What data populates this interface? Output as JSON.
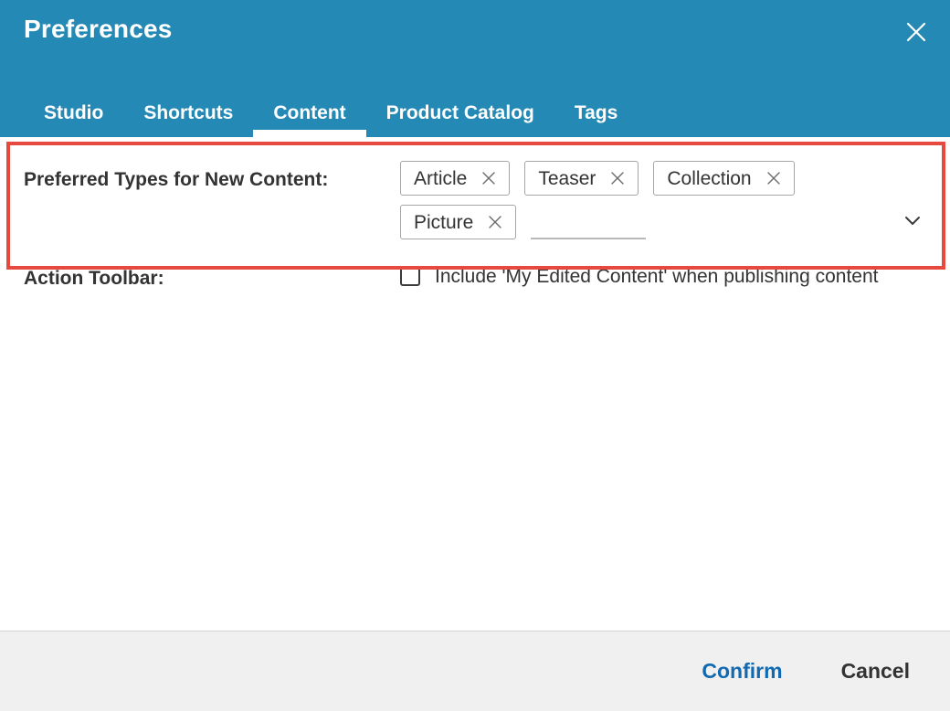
{
  "dialog": {
    "title": "Preferences",
    "close_icon": "close-icon"
  },
  "tabs": [
    {
      "label": "Studio",
      "active": false
    },
    {
      "label": "Shortcuts",
      "active": false
    },
    {
      "label": "Content",
      "active": true
    },
    {
      "label": "Product Catalog",
      "active": false
    },
    {
      "label": "Tags",
      "active": false
    }
  ],
  "content_tab": {
    "preferred_types": {
      "label": "Preferred Types for New Content:",
      "chips": [
        {
          "label": "Article",
          "remove_icon": "close-icon"
        },
        {
          "label": "Teaser",
          "remove_icon": "close-icon"
        },
        {
          "label": "Collection",
          "remove_icon": "close-icon"
        },
        {
          "label": "Picture",
          "remove_icon": "close-icon"
        }
      ],
      "input_value": "",
      "input_placeholder": "",
      "dropdown_icon": "chevron-down-icon"
    },
    "action_toolbar": {
      "label": "Action Toolbar:",
      "checkbox_label": "Include 'My Edited Content' when publishing content",
      "checked": false
    }
  },
  "footer": {
    "confirm_label": "Confirm",
    "cancel_label": "Cancel"
  },
  "colors": {
    "header": "#2489b4",
    "accent_link": "#1269b0",
    "annotation": "#e8493f",
    "footer_bg": "#f0f0f0"
  }
}
